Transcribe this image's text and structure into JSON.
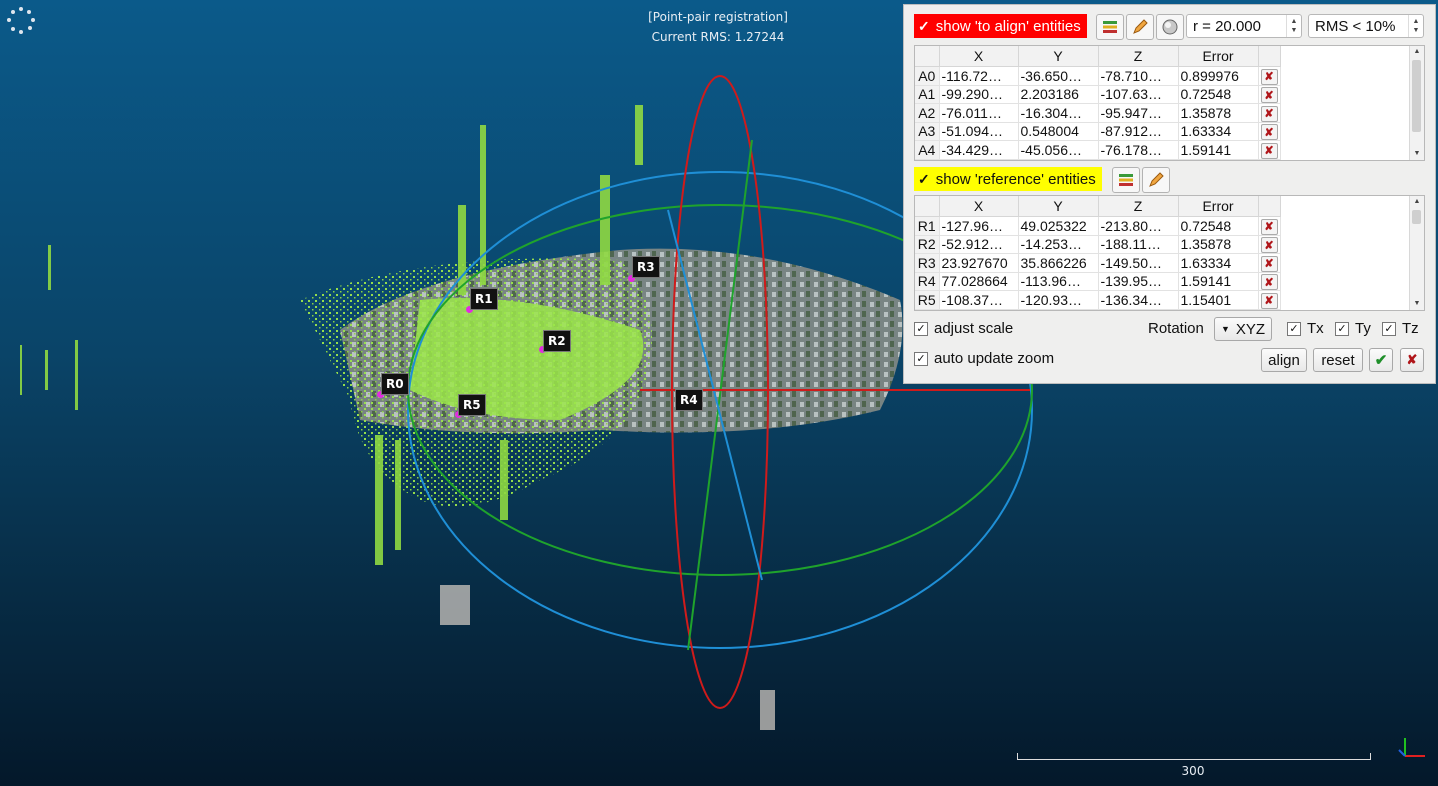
{
  "overlay": {
    "mode_title": "[Point-pair registration]",
    "rms_text": "Current RMS: 1.27244",
    "scale_value": "300"
  },
  "markers": {
    "R0": "R0",
    "R1": "R1",
    "R2": "R2",
    "R3": "R3",
    "R4": "R4",
    "R5": "R5"
  },
  "panel": {
    "align_checkbox_label": "show 'to align' entities",
    "align_color": "#ff0000",
    "ref_checkbox_label": "show 'reference' entities",
    "ref_color": "#ffff00",
    "radius_value": "r = 20.000",
    "rms_filter": "RMS < 10%",
    "align_table": {
      "headers": [
        "X",
        "Y",
        "Z",
        "Error"
      ],
      "rows": [
        {
          "id": "A0",
          "x": "-116.72…",
          "y": "-36.650…",
          "z": "-78.710…",
          "err": "0.899976"
        },
        {
          "id": "A1",
          "x": "-99.290…",
          "y": "2.203186",
          "z": "-107.63…",
          "err": "0.72548"
        },
        {
          "id": "A2",
          "x": "-76.011…",
          "y": "-16.304…",
          "z": "-95.947…",
          "err": "1.35878"
        },
        {
          "id": "A3",
          "x": "-51.094…",
          "y": "0.548004",
          "z": "-87.912…",
          "err": "1.63334"
        },
        {
          "id": "A4",
          "x": "-34.429…",
          "y": "-45.056…",
          "z": "-76.178…",
          "err": "1.59141"
        }
      ]
    },
    "ref_table": {
      "headers": [
        "X",
        "Y",
        "Z",
        "Error"
      ],
      "rows": [
        {
          "id": "R1",
          "x": "-127.96…",
          "y": "49.025322",
          "z": "-213.80…",
          "err": "0.72548"
        },
        {
          "id": "R2",
          "x": "-52.912…",
          "y": "-14.253…",
          "z": "-188.11…",
          "err": "1.35878"
        },
        {
          "id": "R3",
          "x": "23.927670",
          "y": "35.866226",
          "z": "-149.50…",
          "err": "1.63334"
        },
        {
          "id": "R4",
          "x": "77.028664",
          "y": "-113.96…",
          "z": "-139.95…",
          "err": "1.59141"
        },
        {
          "id": "R5",
          "x": "-108.37…",
          "y": "-120.93…",
          "z": "-136.34…",
          "err": "1.15401"
        }
      ]
    },
    "adjust_scale_label": "adjust scale",
    "auto_update_zoom_label": "auto update zoom",
    "rotation_label": "Rotation",
    "rotation_value": "XYZ",
    "tx_label": "Tx",
    "ty_label": "Ty",
    "tz_label": "Tz",
    "align_button": "align",
    "reset_button": "reset"
  }
}
